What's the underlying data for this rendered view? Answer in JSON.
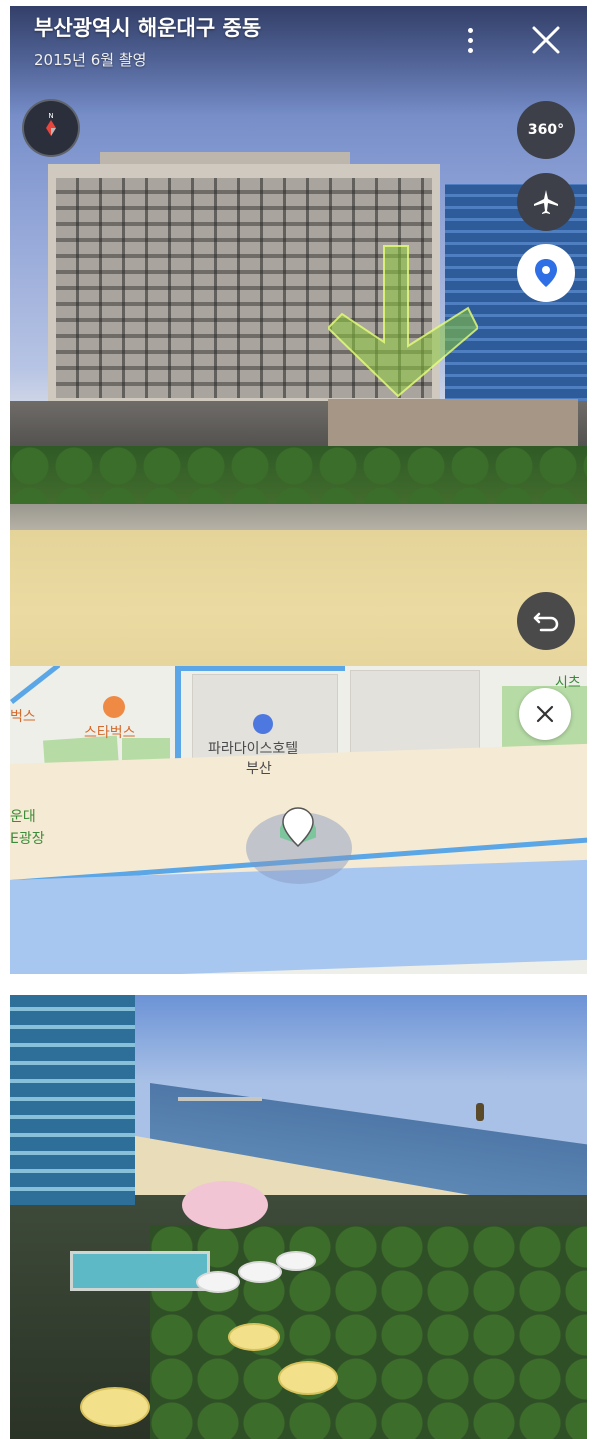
{
  "streetview": {
    "location_title": "부산광역시 해운대구 중동",
    "capture_date": "2015년 6월 촬영",
    "buttons": {
      "view_360_label": "360°"
    },
    "icons": [
      "compass-icon",
      "360-rotate-icon",
      "airplane-icon",
      "location-pin-icon",
      "back-arrow-icon",
      "more-vertical-icon",
      "close-icon"
    ]
  },
  "map": {
    "labels": {
      "starbucks": "스타벅스",
      "hotel_line1": "파라다이스호텔",
      "hotel_line2": "부산",
      "left_partial_1": "벅스",
      "left_partial_2": "운대",
      "left_partial_3": "E광장",
      "right_partial": "시츠"
    },
    "colors": {
      "road": "#5aa6e6",
      "sea": "#a8c7f0",
      "sand": "#f5ead3",
      "park": "#b6dba5"
    }
  },
  "photo": {
    "description_colors": {
      "sky": "#a9c1e6",
      "sea": "#5d88b5",
      "umbrella": "#f2e08a"
    }
  }
}
